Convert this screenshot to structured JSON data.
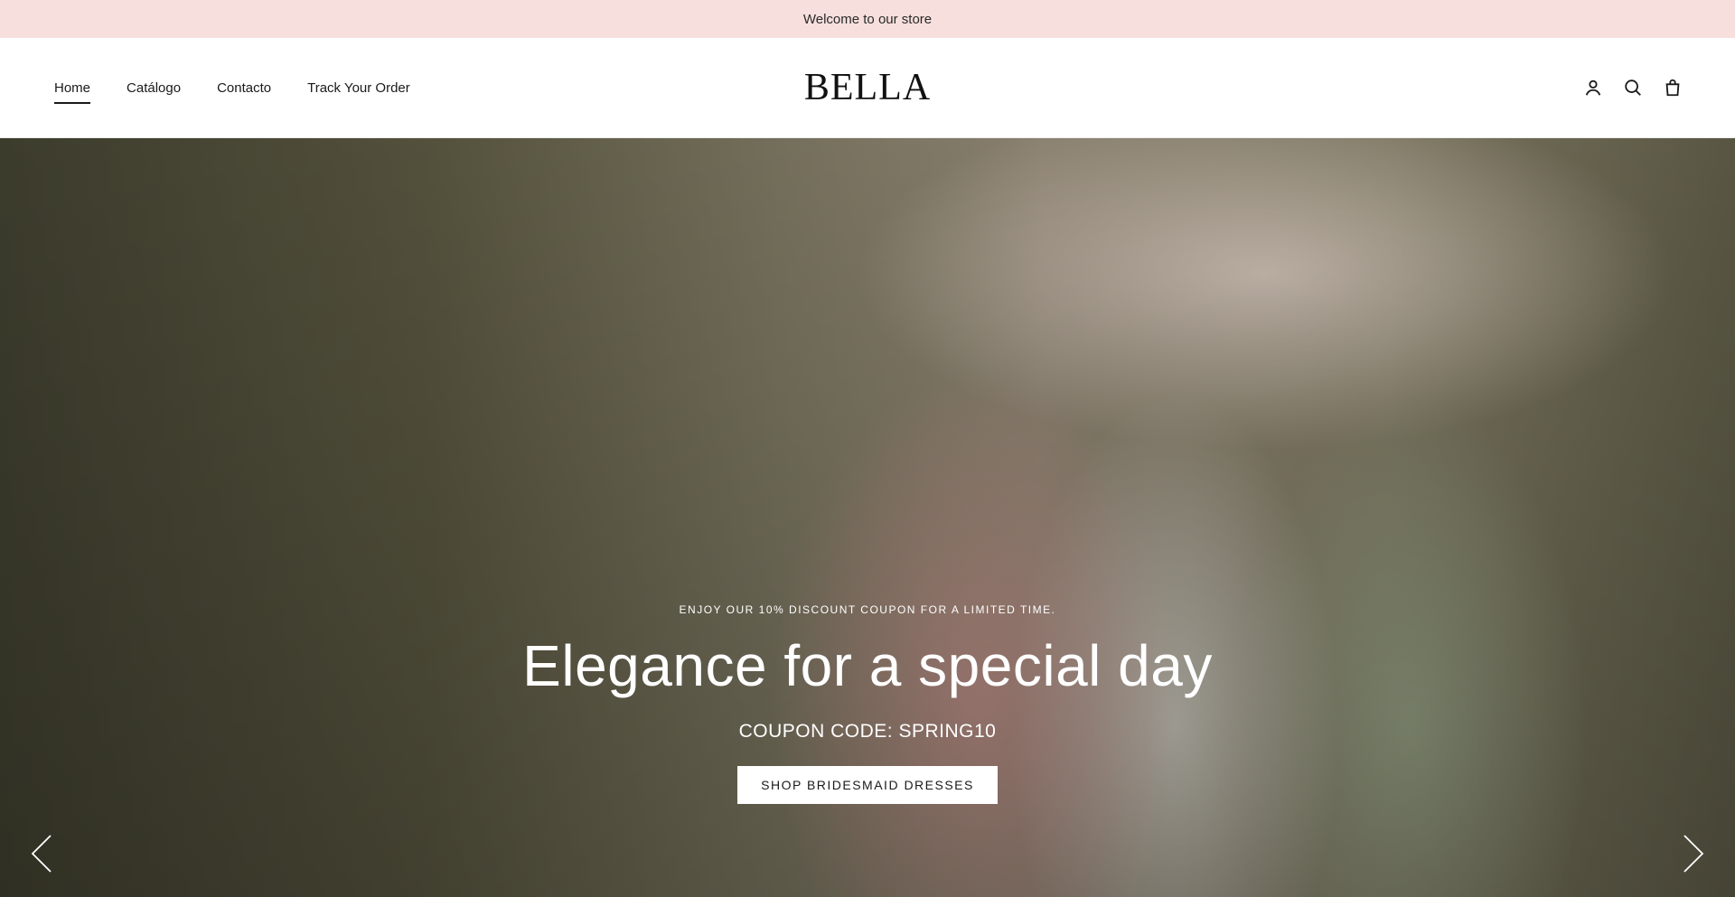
{
  "announcement": {
    "text": "Welcome to our store"
  },
  "header": {
    "nav": [
      {
        "label": "Home",
        "active": true
      },
      {
        "label": "Catálogo",
        "active": false
      },
      {
        "label": "Contacto",
        "active": false
      },
      {
        "label": "Track Your Order",
        "active": false
      }
    ],
    "logo": "BELLA",
    "icons": [
      "account-icon",
      "search-icon",
      "cart-icon"
    ]
  },
  "hero": {
    "eyebrow": "ENJOY OUR 10% DISCOUNT COUPON FOR A LIMITED TIME.",
    "title": "Elegance for a special day",
    "subtitle": "COUPON CODE: SPRING10",
    "button_label": "SHOP BRIDESMAID DRESSES",
    "prev_icon": "chevron-left-icon",
    "next_icon": "chevron-right-icon"
  },
  "colors": {
    "announcement_bg": "#f7dfdd",
    "text": "#1a1a1a",
    "button_bg": "#ffffff"
  }
}
